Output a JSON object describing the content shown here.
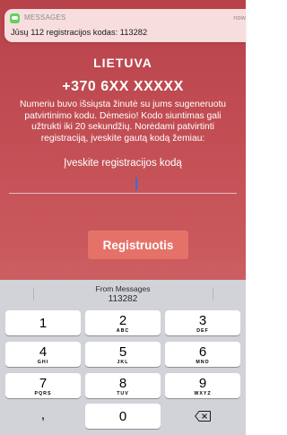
{
  "screen": {
    "country": "LIETUVA",
    "phone_number": "+370 6XX XXXXX",
    "info_text": "Numeriu buvo išsiųsta žinutė su jums sugeneruotu patvirtinimo kodu. Dėmesio! Kodo siuntimas gali užtrukti iki 20 sekundžių. Norėdami patvirtinti registraciją, įveskite gautą kodą žemiau:",
    "code_label": "Įveskite registracijos kodą",
    "code_value": "",
    "register_button": "Registruotis"
  },
  "notification": {
    "app_name": "MESSAGES",
    "time": "now",
    "message": "Jūsų 112 registracijos kodas: 113282",
    "icon": "messages-app-icon"
  },
  "keyboard": {
    "suggestion": {
      "label": "From Messages",
      "code": "113282"
    },
    "keys": [
      {
        "num": "1",
        "letters": ""
      },
      {
        "num": "2",
        "letters": "ABC"
      },
      {
        "num": "3",
        "letters": "DEF"
      },
      {
        "num": "4",
        "letters": "GHI"
      },
      {
        "num": "5",
        "letters": "JKL"
      },
      {
        "num": "6",
        "letters": "MNO"
      },
      {
        "num": "7",
        "letters": "PQRS"
      },
      {
        "num": "8",
        "letters": "TUV"
      },
      {
        "num": "9",
        "letters": "WXYZ"
      }
    ],
    "comma": ",",
    "zero": "0",
    "backspace_icon": "backspace-icon"
  },
  "colors": {
    "background_top": "#b8424a",
    "background_bottom": "#d67072",
    "register_button": "#e57268",
    "keyboard_background": "#d1d3d8",
    "notification_icon": "#5fd45a",
    "text_cursor": "#2f6ee0"
  }
}
